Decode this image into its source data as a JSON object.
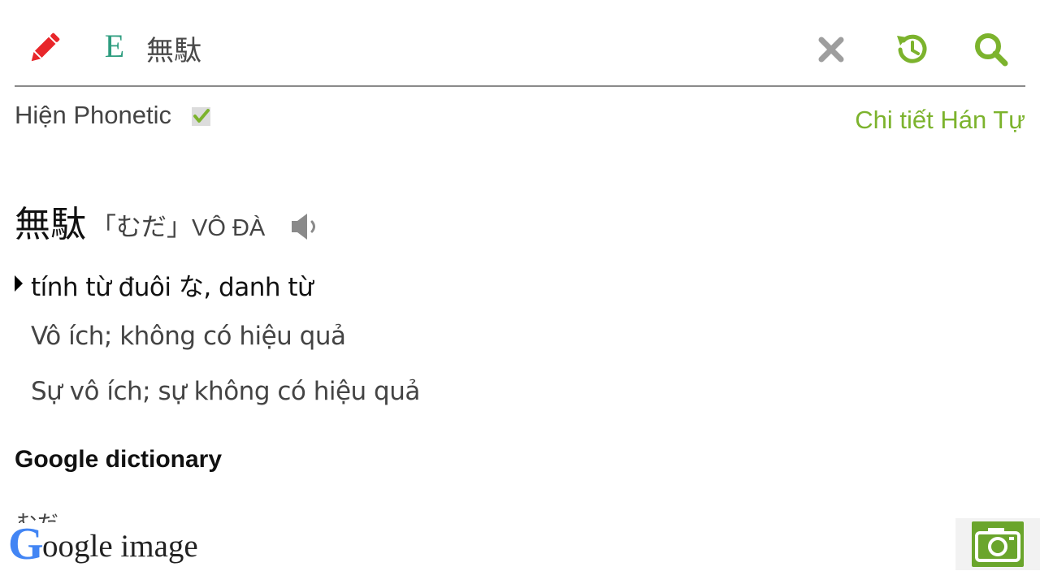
{
  "header": {
    "lang_toggle_label": "E",
    "search_value": "無駄",
    "search_placeholder": ""
  },
  "options": {
    "phonetic_label": "Hiện Phonetic",
    "phonetic_checked": true,
    "kanji_detail_link": "Chi tiết Hán Tự"
  },
  "entry": {
    "word": "無駄",
    "reading": "「むだ」",
    "hanviet": "VÔ ĐÀ",
    "part_of_speech": "tính từ đuôi な, danh từ",
    "meanings": [
      "Vô ích; không có hiệu quả",
      "Sự vô ích; sự không có hiệu quả"
    ]
  },
  "google_dictionary": {
    "heading": "Google dictionary",
    "partial_text": "むだ"
  },
  "google_image": {
    "logo_letter": "G",
    "label": "oogle image"
  },
  "icons": {
    "pencil": "pencil-icon",
    "clear": "close-icon",
    "history": "history-icon",
    "search": "search-icon",
    "speaker": "speaker-icon",
    "camera": "camera-icon"
  },
  "colors": {
    "accent_green": "#7cb32d",
    "pencil_red": "#e8262a",
    "lang_teal": "#2e9d7f",
    "clear_gray": "#9e9e9e",
    "camera_green": "#6aa52c"
  }
}
